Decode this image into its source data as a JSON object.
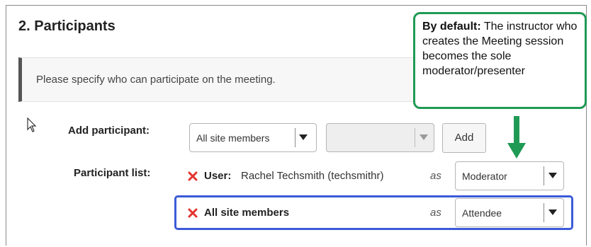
{
  "section": {
    "title": "2. Participants"
  },
  "info": {
    "text": "Please specify who can participate on the meeting."
  },
  "add_participant": {
    "label": "Add participant:",
    "scope_select": "All site members",
    "target_select": "",
    "add_button": "Add"
  },
  "participant_list": {
    "label": "Participant list:",
    "rows": [
      {
        "prefix": "User:",
        "name": "Rachel Techsmith (techsmithr)",
        "as": "as",
        "role": "Moderator"
      },
      {
        "prefix": "",
        "name": "All site members",
        "as": "as",
        "role": "Attendee"
      }
    ]
  },
  "callout": {
    "lead": "By default:",
    "text": "The instructor who creates the Meeting session becomes the sole moderator/presenter"
  },
  "colors": {
    "remove_icon": "#e3342f",
    "highlight_border": "#3b5bd8",
    "callout_border": "#1f9a55"
  }
}
